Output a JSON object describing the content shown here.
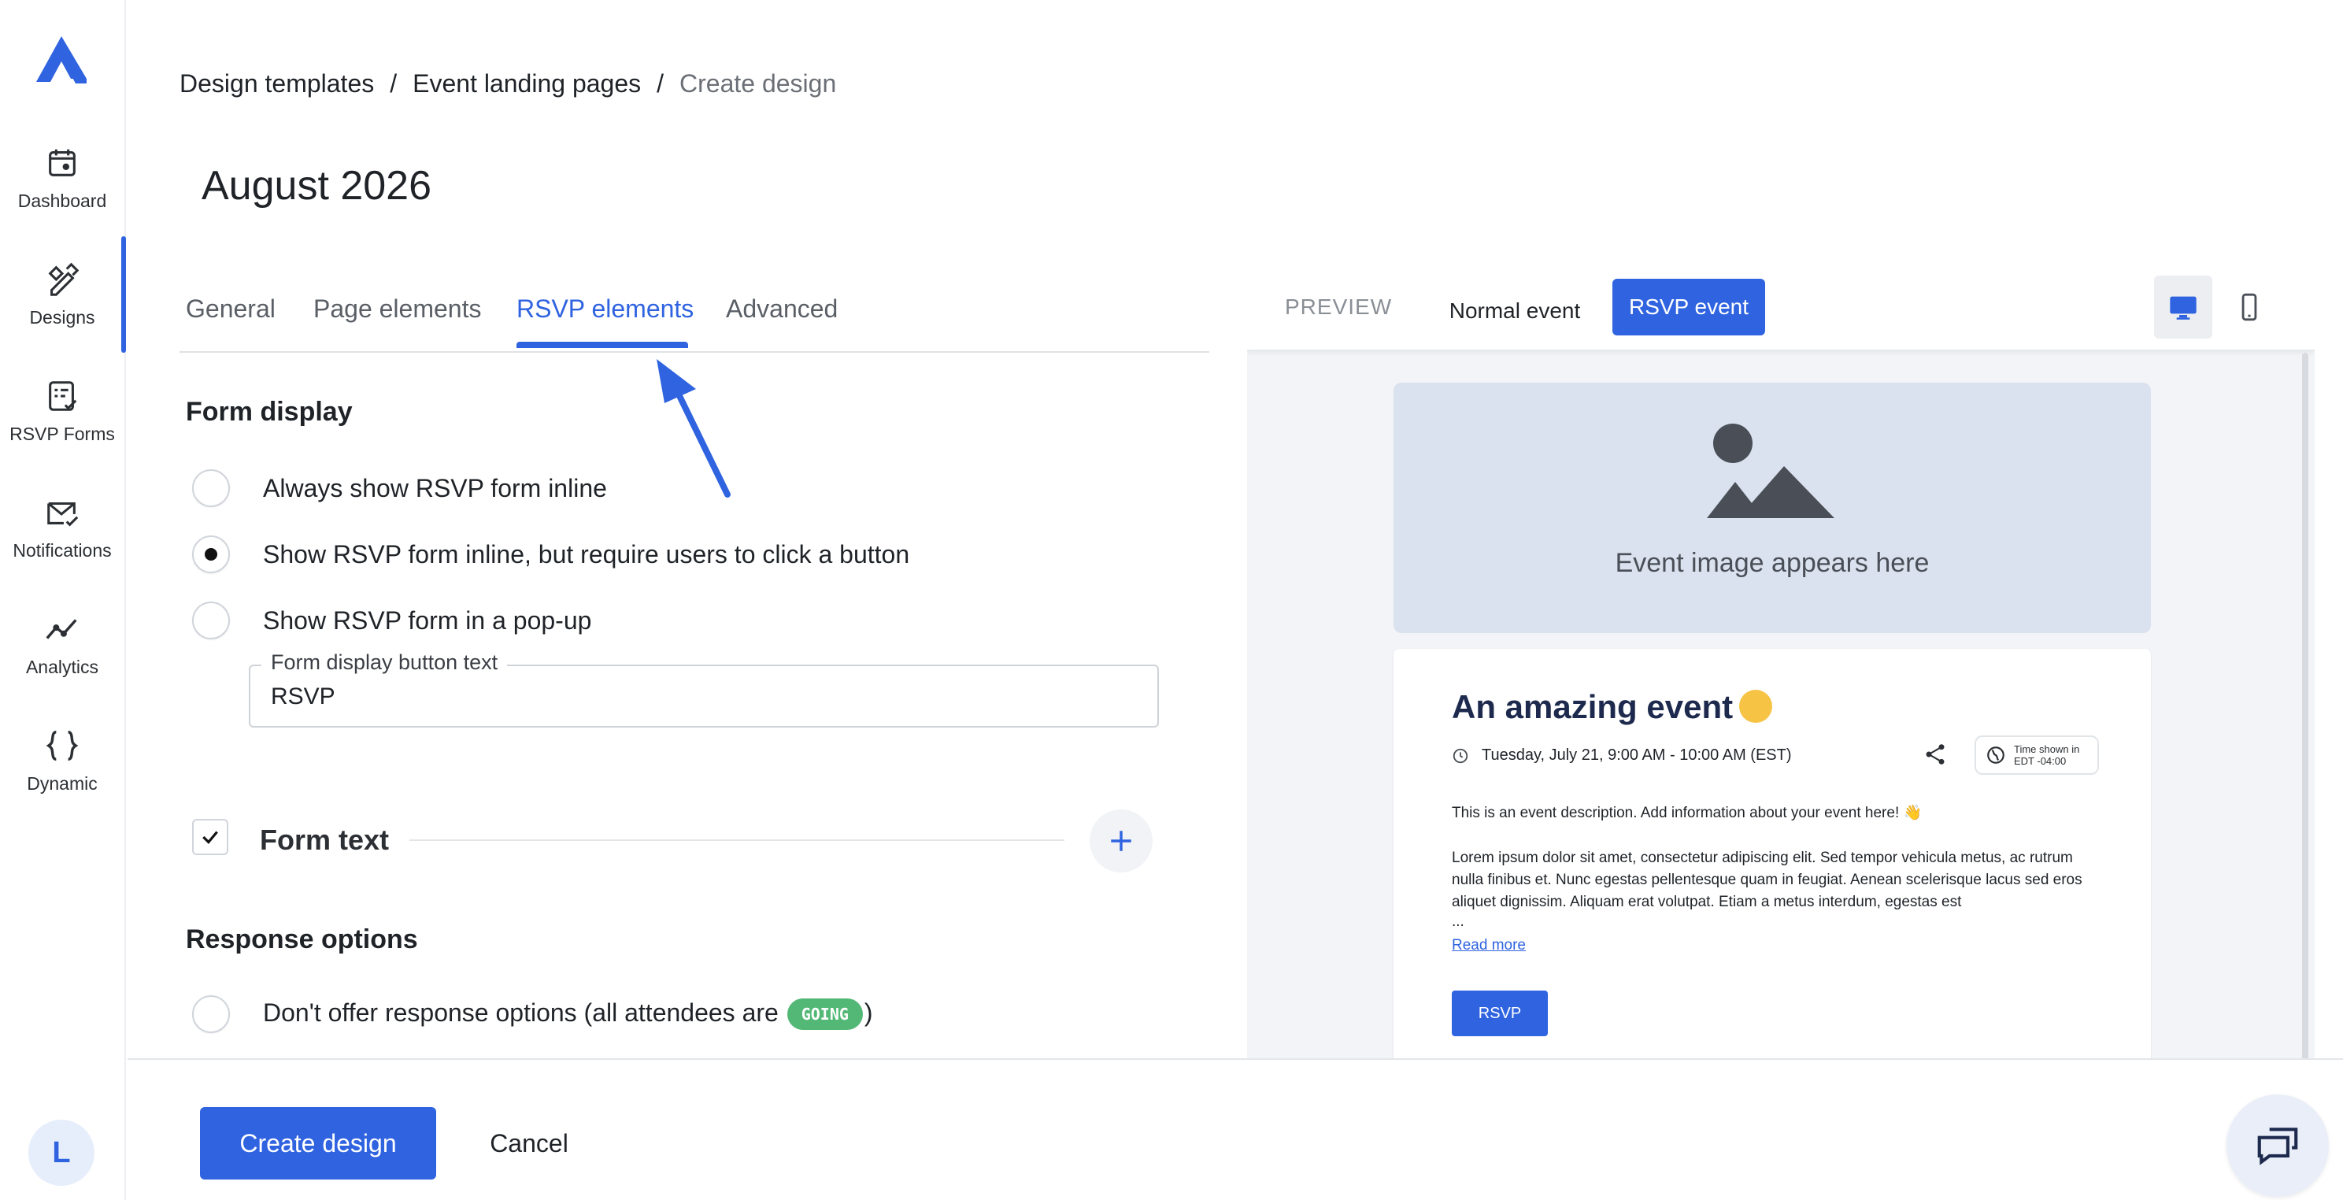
{
  "sidebar": {
    "items": [
      {
        "label": "Dashboard",
        "icon": "calendar-icon"
      },
      {
        "label": "Designs",
        "icon": "designs-icon"
      },
      {
        "label": "RSVP Forms",
        "icon": "forms-icon"
      },
      {
        "label": "Notifications",
        "icon": "mail-icon"
      },
      {
        "label": "Analytics",
        "icon": "analytics-icon"
      },
      {
        "label": "Dynamic",
        "icon": "braces-icon"
      }
    ],
    "active": "Designs",
    "avatar_initial": "L"
  },
  "breadcrumb": {
    "items": [
      "Design templates",
      "Event landing pages",
      "Create design"
    ],
    "separator": "/"
  },
  "page_title": "August 2026",
  "tabs": [
    "General",
    "Page elements",
    "RSVP elements",
    "Advanced"
  ],
  "active_tab": "RSVP elements",
  "form_display": {
    "heading": "Form display",
    "options": [
      "Always show RSVP form inline",
      "Show RSVP form inline, but require users to click a button",
      "Show RSVP form in a pop-up"
    ],
    "selected_index": 1,
    "button_text_field": {
      "label": "Form display button text",
      "value": "RSVP"
    }
  },
  "form_text": {
    "label": "Form text",
    "checked": true
  },
  "response_options": {
    "heading": "Response options",
    "option_prefix": "Don't offer response options (all attendees are",
    "badge": "GOING",
    "option_suffix": ")"
  },
  "preview": {
    "label": "PREVIEW",
    "toggle_normal": "Normal event",
    "toggle_rsvp": "RSVP event",
    "image_caption": "Event image appears here",
    "event": {
      "title": "An amazing event",
      "date": "Tuesday, July 21, 9:00 AM - 10:00 AM (EST)",
      "tz_line1": "Time shown in",
      "tz_line2": "EDT -04:00",
      "description": "This is an event description. Add information about your event here! 👋",
      "lorem": "Lorem ipsum dolor sit amet, consectetur adipiscing elit. Sed tempor vehicula metus, ac rutrum nulla finibus et. Nunc egestas pellentesque quam in feugiat. Aenean scelerisque lacus sed eros aliquet dignissim. Aliquam erat volutpat. Etiam a metus interdum, egestas est",
      "ellipsis": "...",
      "read_more": "Read more",
      "rsvp_button": "RSVP"
    }
  },
  "footer": {
    "create": "Create design",
    "cancel": "Cancel"
  },
  "colors": {
    "accent": "#2f63e0",
    "going": "#53b876"
  }
}
